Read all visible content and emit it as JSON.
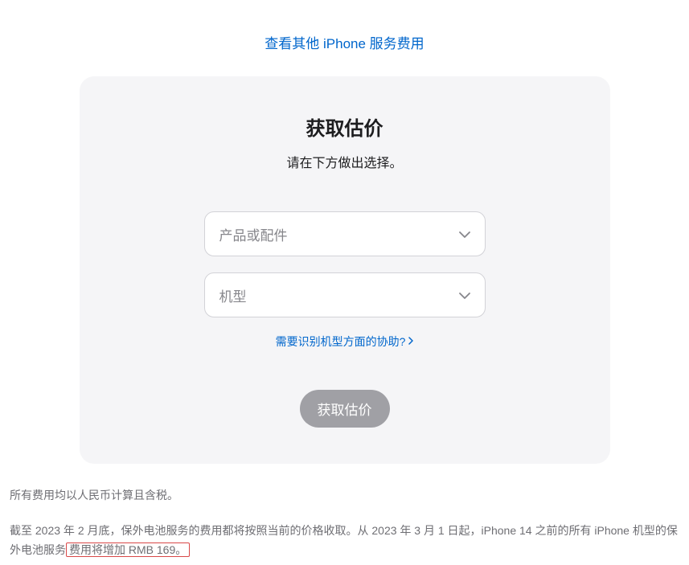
{
  "topLink": "查看其他 iPhone 服务费用",
  "card": {
    "title": "获取估价",
    "subtitle": "请在下方做出选择。",
    "selectProduct": "产品或配件",
    "selectModel": "机型",
    "helpLink": "需要识别机型方面的协助?",
    "submitButton": "获取估价"
  },
  "footnotes": {
    "line1": "所有费用均以人民币计算且含税。",
    "line2Before": "截至 2023 年 2 月底，保外电池服务的费用都将按照当前的价格收取。从 2023 年 3 月 1 日起，iPhone 14 之前的所有 iPhone 机型的保外电池服务",
    "line2Highlighted": "费用将增加 RMB 169。"
  }
}
